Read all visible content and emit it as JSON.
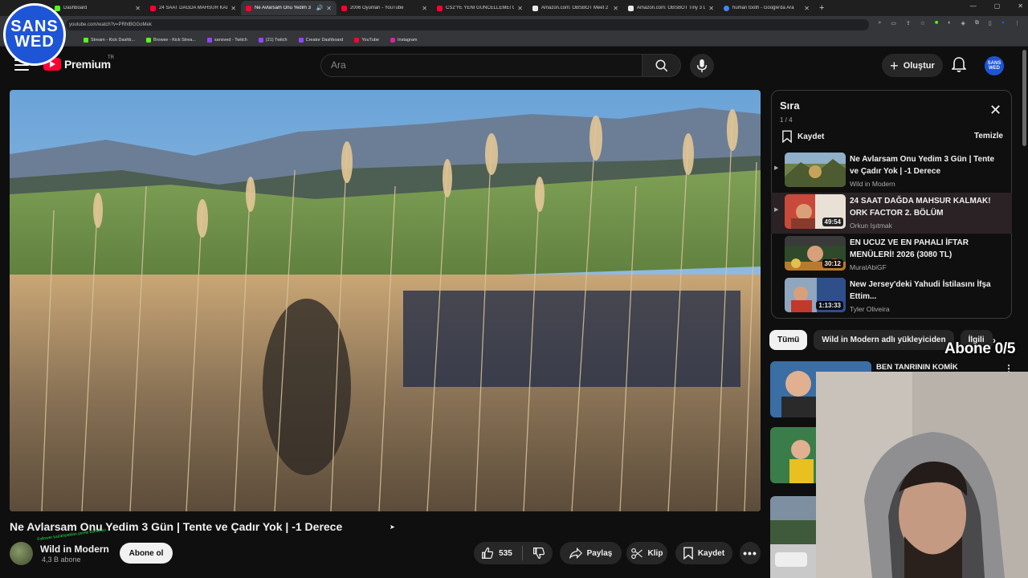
{
  "browser": {
    "tabs": [
      {
        "title": "Dashboard",
        "icon": "kick-icon"
      },
      {
        "title": "24 SAAT DAĞDA MAHSUR KAL...",
        "icon": "youtube-icon"
      },
      {
        "title": "Ne Avlarsam Onu Yedim 3",
        "icon": "youtube-icon",
        "active": true
      },
      {
        "title": "2006 Oyunları - YouTube",
        "icon": "youtube-icon"
      },
      {
        "title": "CS2'YE YENİ GÜNCELLEMEI CS",
        "icon": "youtube-icon"
      },
      {
        "title": "Amazon.com: OBSBOT Meet 2",
        "icon": "amazon-icon"
      },
      {
        "title": "Amazon.com: OBSBOT Tiny 3 L",
        "icon": "amazon-icon"
      },
      {
        "title": "human tooth - Google'da Ara",
        "icon": "google-icon"
      }
    ],
    "new_tab": "+",
    "url": "youtube.com/watch?v=PRhtBGGoMek",
    "bookmarks": [
      {
        "label": "Stream - Kick Dashb...",
        "type": "kick"
      },
      {
        "label": "Browse - Kick Strea...",
        "type": "kick"
      },
      {
        "label": "sansved - Twitch",
        "type": "twitch"
      },
      {
        "label": "(21) Twitch",
        "type": "twitch"
      },
      {
        "label": "Creator Dashboard",
        "type": "twitch"
      },
      {
        "label": "YouTube",
        "type": "youtube"
      },
      {
        "label": "Instagram",
        "type": "instagram"
      }
    ]
  },
  "overlay": {
    "logo_line1": "SANS",
    "logo_line2": "WED",
    "sub_goal": "Abone 0/5"
  },
  "header": {
    "brand": "Premium",
    "region": "TR",
    "search_placeholder": "Ara",
    "create_label": "Oluştur",
    "avatar_line1": "SANS",
    "avatar_line2": "WED"
  },
  "video": {
    "title": "Ne Avlarsam Onu Yedim 3 Gün | Tente ve Çadır Yok | -1 Derece",
    "channel": "Wild in Modern",
    "subscribers": "4,3 B abone",
    "subscribe_label": "Abone ol",
    "likes": "535",
    "share_label": "Paylaş",
    "clip_label": "Klip",
    "save_label": "Kaydet",
    "overlay_caption": "Follower kadıköpeklan yemle kamerayı..."
  },
  "playlist": {
    "title": "Sıra",
    "count": "1 / 4",
    "save_label": "Kaydet",
    "clear_label": "Temizle",
    "items": [
      {
        "title": "Ne Avlarsam Onu Yedim 3 Gün | Tente ve Çadır Yok | -1 Derece",
        "channel": "Wild in Modern",
        "duration": ""
      },
      {
        "title": "24 SAAT DAĞDA MAHSUR KALMAK! ORK FACTOR 2. BÖLÜM",
        "channel": "Orkun Işıtmak",
        "duration": "49:54"
      },
      {
        "title": "EN UCUZ VE EN PAHALI İFTAR MENÜLERİ! 2026 (3080 TL)",
        "channel": "MuratAbiGF",
        "duration": "30:12"
      },
      {
        "title": "New Jersey'deki Yahudi İstilasını İfşa Ettim...",
        "channel": "Tyler Oliveira",
        "duration": "1:13:33"
      }
    ]
  },
  "chips": [
    "Tümü",
    "Wild in Modern adlı yükleyiciden",
    "İlgili"
  ],
  "recommendations": [
    {
      "title": "BEN TANRININ KOMİK"
    }
  ],
  "colors": {
    "youtube_red": "#ff0033",
    "logo_blue": "#1e54d6",
    "background": "#0f0f0f"
  }
}
